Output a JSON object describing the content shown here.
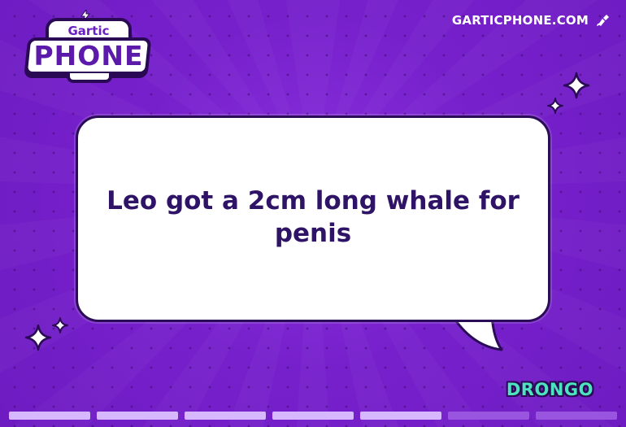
{
  "logo": {
    "top_text": "Gartic",
    "bottom_text": "PHONE",
    "bolt_icon": "lightning-bolt-icon"
  },
  "site_link": {
    "label": "GARTICPHONE.COM",
    "icon": "paintbrush-icon"
  },
  "bubble": {
    "text": "Leo got a 2cm long whale for penis"
  },
  "player": {
    "name": "DRONGO"
  },
  "progress": {
    "total_steps": 7,
    "completed_steps": 5
  },
  "colors": {
    "background": "#7620cc",
    "bubble_text": "#2f1366",
    "player_name": "#4ee3c0",
    "progress_done": "#d7b8ff",
    "progress_pending": "#9a55e0"
  }
}
